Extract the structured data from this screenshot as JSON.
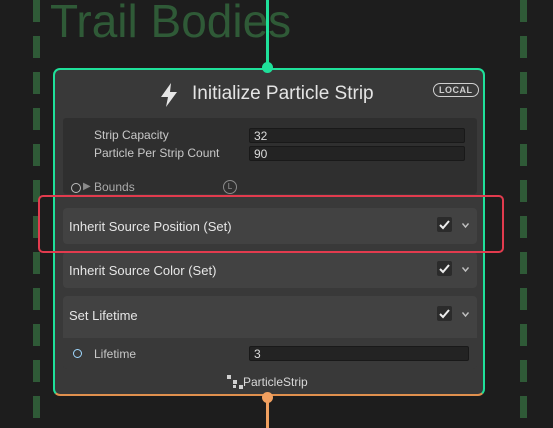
{
  "group": {
    "title": "Trail Bodies"
  },
  "node": {
    "title": "Initialize Particle Strip",
    "badge": "LOCAL",
    "settings": {
      "strip_capacity_label": "Strip Capacity",
      "strip_capacity_value": "32",
      "particle_per_strip_label": "Particle Per Strip Count",
      "particle_per_strip_value": "90",
      "bounds_label": "Bounds",
      "bounds_space": "L"
    },
    "blocks": [
      {
        "title": "Inherit Source Position (Set)",
        "enabled": true
      },
      {
        "title": "Inherit Source Color (Set)",
        "enabled": true
      },
      {
        "title": "Set Lifetime",
        "enabled": true
      }
    ],
    "lifetime": {
      "label": "Lifetime",
      "value": "3"
    },
    "footer": "ParticleStrip"
  },
  "colors": {
    "input_flow": "#1fe09a",
    "output_flow": "#f0a060",
    "group_dash": "#2f5a37",
    "highlight": "#e23b4e"
  }
}
